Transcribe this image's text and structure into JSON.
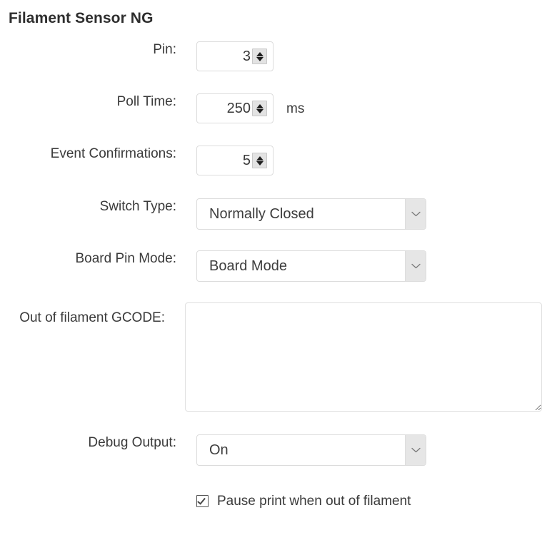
{
  "page": {
    "title": "Filament Sensor NG"
  },
  "form": {
    "pin": {
      "label": "Pin:",
      "value": "3"
    },
    "poll_time": {
      "label": "Poll Time:",
      "value": "250",
      "unit": "ms"
    },
    "event_confirmations": {
      "label": "Event Confirmations:",
      "value": "5"
    },
    "switch_type": {
      "label": "Switch Type:",
      "value": "Normally Closed"
    },
    "board_pin_mode": {
      "label": "Board Pin Mode:",
      "value": "Board Mode"
    },
    "out_of_filament_gcode": {
      "label": "Out of filament GCODE:",
      "value": "",
      "placeholder": ""
    },
    "debug_output": {
      "label": "Debug Output:",
      "value": "On"
    },
    "pause_print": {
      "label": "Pause print when out of filament",
      "checked": true
    }
  },
  "icons": {
    "spinner_up": "spinner-up-arrow-icon",
    "spinner_down": "spinner-down-arrow-icon",
    "select_chevron": "chevron-down-icon",
    "checkbox_tick": "checkmark-icon"
  },
  "colors": {
    "background": "#ffffff",
    "text": "#3a3a3a",
    "heading": "#2e2e2e",
    "border": "#dcdcdc",
    "select_button": "#e6e6e6",
    "spinner_button": "#e3e3e3"
  }
}
